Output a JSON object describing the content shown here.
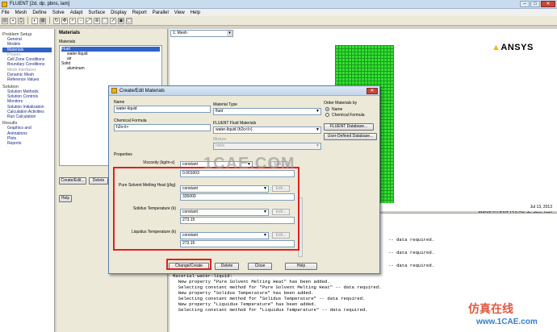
{
  "window": {
    "title": "FLUENT  [2d, dp, pbns, lam]",
    "buttons": [
      "–",
      "□",
      "✕"
    ]
  },
  "menu": [
    "File",
    "Mesh",
    "Define",
    "Solve",
    "Adapt",
    "Surface",
    "Display",
    "Report",
    "Parallel",
    "View",
    "Help"
  ],
  "tree": {
    "sections": [
      {
        "title": "Problem Setup",
        "items": [
          "General",
          "Models",
          "Materials",
          "Phases",
          "Cell Zone Conditions",
          "Boundary Conditions",
          "Mesh Interfaces",
          "Dynamic Mesh",
          "Reference Values"
        ]
      },
      {
        "title": "Solution",
        "items": [
          "Solution Methods",
          "Solution Controls",
          "Monitors",
          "Solution Initialization",
          "Calculation Activities",
          "Run Calculation"
        ]
      },
      {
        "title": "Results",
        "items": [
          "Graphics and Animations",
          "Plots",
          "Reports"
        ]
      }
    ],
    "selected": "Materials"
  },
  "materials_page": {
    "title": "Materials",
    "list_label": "Materials",
    "fluid_label": "Fluid",
    "fluid_items": [
      "water-liquid",
      "air"
    ],
    "solid_label": "Solid",
    "solid_items": [
      "aluminum"
    ],
    "create_edit_button": "Create/Edit...",
    "delete_button": "Delete",
    "help_button": "Help"
  },
  "graphics": {
    "view_select": "1: Mesh",
    "logo": "ANSYS",
    "date": "Jul 13, 2013",
    "version": "ANSYS FLUENT 12.0 (2d, dp, pbns, lam)"
  },
  "dialog": {
    "title": "Create/Edit Materials",
    "name_label": "Name",
    "name_value": "water-liquid",
    "formula_label": "Chemical Formula",
    "formula_value": "h2o<l>",
    "material_type_label": "Material Type",
    "material_type_value": "fluid",
    "fluent_materials_label": "FLUENT Fluid Materials",
    "fluent_materials_value": "water-liquid (h2o<l>)",
    "mixture_label": "Mixture",
    "mixture_value": "none",
    "order_label": "Order Materials by",
    "order_options": [
      "Name",
      "Chemical Formula"
    ],
    "fluent_db_button": "FLUENT Database...",
    "user_db_button": "User-Defined Database...",
    "properties_label": "Properties",
    "properties": [
      {
        "label": "Viscosity (kg/m-s)",
        "method": "constant",
        "value": "0.001003"
      },
      {
        "label": "Pure Solvent Melting Heat (j/kg)",
        "method": "constant",
        "value": "335000"
      },
      {
        "label": "Solidus Temperature (k)",
        "method": "constant",
        "value": "273.15"
      },
      {
        "label": "Liquidus Temperature (k)",
        "method": "constant",
        "value": "273.15"
      }
    ],
    "edit_label": "Edit...",
    "change_create_button": "Change/Create",
    "delete_button": "Delete",
    "close_button": "Close",
    "help_button": "Help"
  },
  "console": {
    "partial_lines": [
      "-- data required.",
      "-- data required.",
      "-- data required."
    ],
    "lines": [
      "Material water-liquid:",
      "  New property \"Pure Solvent Melting Heat\" has been added.",
      "  Selecting constant method for \"Pure Solvent Melting Heat\" -- data required.",
      "  New property \"Solidus Temperature\" has been added.",
      "  Selecting constant method for \"Solidus Temperature\" -- data required.",
      "  New property \"Liquidus Temperature\" has been added.",
      "  Selecting constant method for \"Liquidus Temperature\" -- data required."
    ]
  },
  "watermarks": {
    "center": "1CAE.COM",
    "brand_cn": "仿真在线",
    "brand_url": "www.1CAE.com"
  },
  "colors": {
    "highlight": "#e02020",
    "mesh": "#33e033",
    "selection": "#3163c5"
  }
}
